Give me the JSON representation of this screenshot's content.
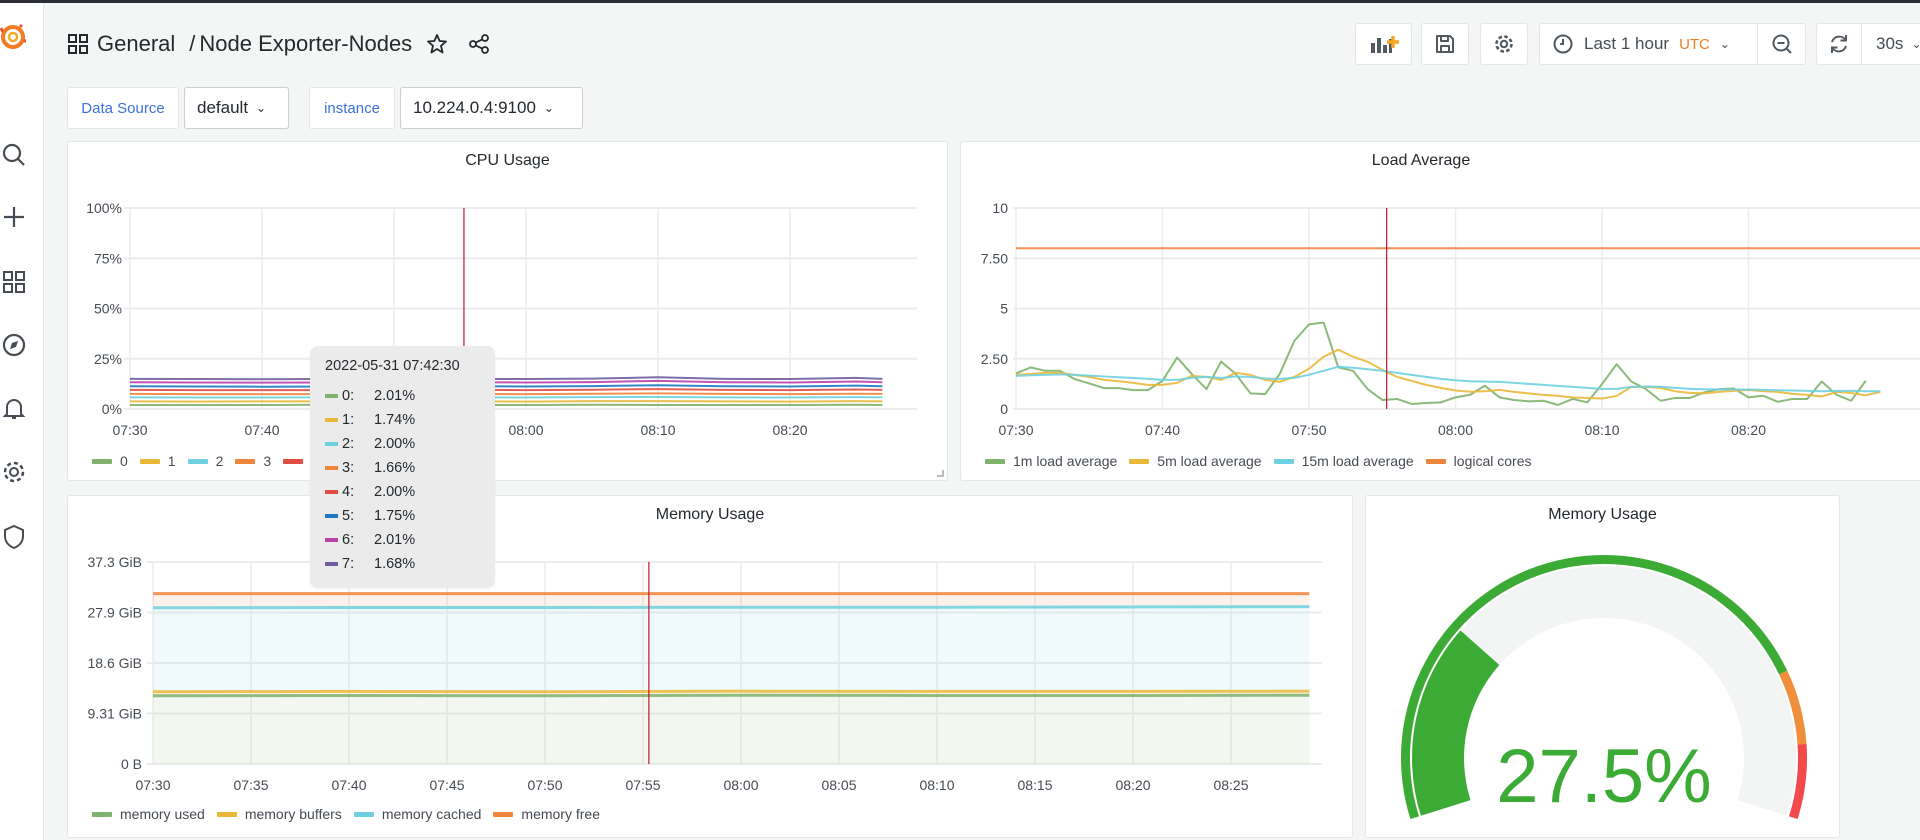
{
  "header": {
    "folder": "General",
    "separator": "/",
    "dashboard_title": "Node Exporter-Nodes",
    "icons": [
      "dashboards-grid-icon",
      "star-icon",
      "share-icon"
    ]
  },
  "toolbar": {
    "add_panel_icon": "add-panel-icon",
    "save_icon": "save-icon",
    "settings_icon": "gear-icon",
    "time_range": "Last 1 hour",
    "timezone": "UTC",
    "zoom_out_icon": "zoom-out-icon",
    "refresh_icon": "refresh-icon",
    "refresh_interval": "30s"
  },
  "variables": [
    {
      "label": "Data Source",
      "value": "default"
    },
    {
      "label": "instance",
      "value": "10.224.0.4:9100"
    }
  ],
  "sidebar": {
    "items": [
      "grafana-logo",
      "search-icon",
      "plus-icon",
      "dashboards-icon",
      "explore-icon",
      "alerting-bell-icon",
      "configuration-gear-icon",
      "server-admin-shield-icon"
    ]
  },
  "colors": {
    "green": "#7eb26d",
    "yellow": "#eab839",
    "cyan": "#6ed0e0",
    "orange": "#ef843c",
    "red": "#e24d42",
    "blue": "#1f78c1",
    "magenta": "#ba43a9",
    "purple": "#705da0",
    "gauge_green": "#3cab35",
    "gauge_orange": "#ef8f3c",
    "gauge_red": "#f2494c",
    "crosshair": "#c4162a"
  },
  "tooltip": {
    "time": "2022-05-31 07:42:30",
    "rows": [
      {
        "key": "0:",
        "value": "2.01%",
        "color": "#7eb26d"
      },
      {
        "key": "1:",
        "value": "1.74%",
        "color": "#eab839"
      },
      {
        "key": "2:",
        "value": "2.00%",
        "color": "#6ed0e0"
      },
      {
        "key": "3:",
        "value": "1.66%",
        "color": "#ef843c"
      },
      {
        "key": "4:",
        "value": "2.00%",
        "color": "#e24d42"
      },
      {
        "key": "5:",
        "value": "1.75%",
        "color": "#1f78c1"
      },
      {
        "key": "6:",
        "value": "2.01%",
        "color": "#ba43a9"
      },
      {
        "key": "7:",
        "value": "1.68%",
        "color": "#705da0"
      }
    ]
  },
  "chart_data": [
    {
      "title": "CPU Usage",
      "type": "line",
      "stacked": true,
      "x_unit": "time",
      "x": [
        "07:30",
        "07:35",
        "07:40",
        "07:45",
        "07:50",
        "07:55",
        "08:00",
        "08:05",
        "08:10",
        "08:15",
        "08:20",
        "08:25",
        "08:27"
      ],
      "xlim": [
        "07:30",
        "08:29"
      ],
      "xticks": [
        "07:30",
        "07:40",
        "07:50",
        "08:00",
        "08:10",
        "08:20"
      ],
      "ylim": [
        0,
        100
      ],
      "yticks": [
        "0%",
        "25%",
        "50%",
        "75%",
        "100%"
      ],
      "grid": true,
      "legend_position": "bottom",
      "series": [
        {
          "name": "0",
          "color": "#7eb26d",
          "values": [
            2.0,
            2.0,
            2.0,
            2.1,
            2.0,
            2.0,
            2.0,
            2.1,
            2.0,
            2.0,
            2.0,
            2.1,
            2.0
          ]
        },
        {
          "name": "1",
          "color": "#eab839",
          "values": [
            1.8,
            1.7,
            1.8,
            1.7,
            1.8,
            1.8,
            1.7,
            1.8,
            1.9,
            1.8,
            1.7,
            1.8,
            1.8
          ]
        },
        {
          "name": "2",
          "color": "#6ed0e0",
          "values": [
            2.0,
            2.0,
            1.9,
            2.0,
            2.0,
            2.0,
            2.0,
            2.0,
            2.1,
            2.0,
            2.0,
            2.0,
            2.0
          ]
        },
        {
          "name": "3",
          "color": "#ef843c",
          "values": [
            1.7,
            1.7,
            1.7,
            1.6,
            1.7,
            1.7,
            1.7,
            1.7,
            1.8,
            1.7,
            1.7,
            1.7,
            1.7
          ]
        },
        {
          "name": "4",
          "color": "#e24d42",
          "values": [
            2.0,
            2.0,
            2.0,
            2.0,
            2.0,
            2.0,
            2.0,
            2.0,
            2.1,
            2.0,
            2.0,
            2.1,
            2.0
          ]
        },
        {
          "name": "5",
          "color": "#1f78c1",
          "values": [
            1.8,
            1.8,
            1.7,
            1.8,
            1.8,
            1.8,
            1.8,
            1.8,
            1.9,
            1.8,
            1.8,
            1.9,
            1.8
          ]
        },
        {
          "name": "6",
          "color": "#ba43a9",
          "values": [
            2.0,
            2.0,
            2.0,
            2.0,
            2.0,
            2.0,
            2.0,
            2.0,
            2.2,
            2.0,
            2.0,
            2.1,
            2.0
          ]
        },
        {
          "name": "7",
          "color": "#705da0",
          "values": [
            1.7,
            1.7,
            1.7,
            1.7,
            1.7,
            1.7,
            1.7,
            1.7,
            1.8,
            1.7,
            1.7,
            1.8,
            1.7
          ]
        }
      ]
    },
    {
      "title": "Load Average",
      "type": "line",
      "stacked": false,
      "x_unit": "time",
      "x_start": "07:30",
      "x_step_minutes": 1,
      "xticks": [
        "07:30",
        "07:40",
        "07:50",
        "08:00",
        "08:10",
        "08:20"
      ],
      "ylim": [
        0,
        10
      ],
      "yticks": [
        "0",
        "2.50",
        "5",
        "7.50",
        "10"
      ],
      "grid": true,
      "legend_position": "bottom",
      "series": [
        {
          "name": "1m load average",
          "color": "#7eb26d",
          "values": [
            1.77,
            2.07,
            1.9,
            1.9,
            1.49,
            1.27,
            1.04,
            1.04,
            0.94,
            0.94,
            1.4,
            2.56,
            1.74,
            0.99,
            2.36,
            1.74,
            0.78,
            0.74,
            1.74,
            3.39,
            4.21,
            4.3,
            2.07,
            1.9,
            0.99,
            0.45,
            0.5,
            0.25,
            0.3,
            0.33,
            0.58,
            0.71,
            1.16,
            0.58,
            0.45,
            0.38,
            0.41,
            0.2,
            0.5,
            0.33,
            1.24,
            2.23,
            1.37,
            0.99,
            0.41,
            0.55,
            0.55,
            0.83,
            0.99,
            1.02,
            0.58,
            0.66,
            0.36,
            0.5,
            0.5,
            1.37,
            0.71,
            0.41,
            1.4
          ]
        },
        {
          "name": "5m load average",
          "color": "#eab839",
          "values": [
            1.7,
            1.75,
            1.8,
            1.8,
            1.7,
            1.6,
            1.45,
            1.38,
            1.3,
            1.2,
            1.2,
            1.3,
            1.65,
            1.6,
            1.45,
            1.8,
            1.7,
            1.45,
            1.35,
            1.6,
            2.0,
            2.6,
            2.95,
            2.6,
            2.35,
            1.95,
            1.6,
            1.4,
            1.2,
            1.05,
            0.92,
            0.86,
            0.88,
            0.95,
            0.85,
            0.78,
            0.7,
            0.65,
            0.58,
            0.55,
            0.52,
            0.65,
            1.1,
            1.1,
            1.05,
            0.88,
            0.8,
            0.78,
            0.85,
            0.9,
            0.95,
            0.88,
            0.85,
            0.75,
            0.7,
            0.62,
            0.85,
            0.8,
            0.68,
            0.85
          ]
        },
        {
          "name": "15m load average",
          "color": "#6ed0e0",
          "values": [
            1.65,
            1.68,
            1.7,
            1.72,
            1.7,
            1.66,
            1.62,
            1.58,
            1.55,
            1.5,
            1.45,
            1.45,
            1.55,
            1.6,
            1.55,
            1.62,
            1.6,
            1.52,
            1.5,
            1.55,
            1.7,
            1.9,
            2.1,
            2.05,
            1.98,
            1.9,
            1.8,
            1.7,
            1.6,
            1.5,
            1.43,
            1.38,
            1.36,
            1.35,
            1.3,
            1.25,
            1.2,
            1.15,
            1.1,
            1.05,
            1.0,
            1.0,
            1.1,
            1.12,
            1.1,
            1.05,
            1.0,
            0.98,
            0.97,
            0.97,
            0.97,
            0.95,
            0.93,
            0.92,
            0.9,
            0.88,
            0.9,
            0.9,
            0.88,
            0.88
          ]
        },
        {
          "name": "logical cores",
          "color": "#ef843c",
          "values": [
            8,
            8,
            8,
            8,
            8,
            8,
            8,
            8,
            8,
            8,
            8,
            8,
            8,
            8,
            8,
            8,
            8,
            8,
            8,
            8,
            8,
            8,
            8,
            8,
            8,
            8,
            8,
            8,
            8,
            8,
            8,
            8,
            8,
            8,
            8,
            8,
            8,
            8,
            8,
            8,
            8,
            8,
            8,
            8,
            8,
            8,
            8,
            8,
            8,
            8,
            8,
            8,
            8,
            8,
            8,
            8,
            8,
            8,
            8,
            8,
            8,
            8,
            8,
            8,
            8
          ]
        }
      ]
    },
    {
      "title": "Memory Usage",
      "type": "area",
      "stacked": true,
      "x_unit": "time",
      "x": [
        "07:30",
        "07:40",
        "07:50",
        "08:00",
        "08:10",
        "08:20",
        "08:29"
      ],
      "xticks": [
        "07:30",
        "07:35",
        "07:40",
        "07:45",
        "07:50",
        "07:55",
        "08:00",
        "08:05",
        "08:10",
        "08:15",
        "08:20",
        "08:25"
      ],
      "ylim": [
        0,
        37.3
      ],
      "yticks": [
        "0 B",
        "9.31 GiB",
        "18.6 GiB",
        "27.9 GiB",
        "37.3 GiB"
      ],
      "y_unit": "GiB",
      "grid": true,
      "legend_position": "bottom",
      "series": [
        {
          "name": "memory used",
          "color": "#7eb26d",
          "values": [
            12.6,
            12.65,
            12.6,
            12.7,
            12.65,
            12.65,
            12.7
          ]
        },
        {
          "name": "memory buffers",
          "color": "#eab839",
          "values": [
            0.75,
            0.75,
            0.75,
            0.75,
            0.75,
            0.75,
            0.75
          ]
        },
        {
          "name": "memory cached",
          "color": "#6ed0e0",
          "values": [
            15.5,
            15.5,
            15.55,
            15.5,
            15.55,
            15.6,
            15.6
          ]
        },
        {
          "name": "memory free",
          "color": "#ef843c",
          "values": [
            2.6,
            2.55,
            2.55,
            2.5,
            2.5,
            2.45,
            2.4
          ]
        }
      ]
    },
    {
      "title": "Memory Usage",
      "type": "gauge",
      "value": 27.5,
      "display": "27.5%",
      "min": 0,
      "max": 100,
      "thresholds": [
        {
          "from": 0,
          "color": "#3cab35"
        },
        {
          "from": 80,
          "color": "#ef8f3c"
        },
        {
          "from": 90,
          "color": "#f2494c"
        }
      ]
    }
  ]
}
